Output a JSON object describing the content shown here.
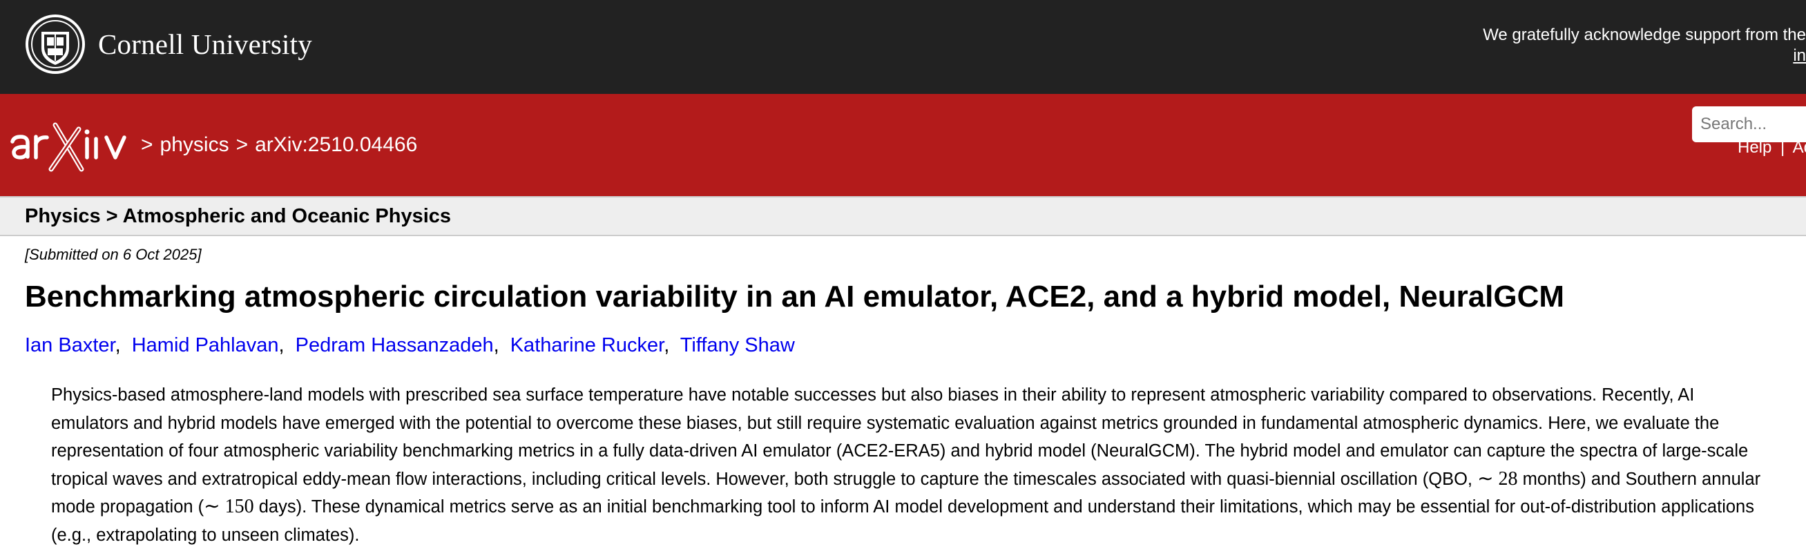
{
  "top_bar": {
    "institution_name": "Cornell University",
    "support_text": "We gratefully acknowledge support from the",
    "support_link_text": "in"
  },
  "header": {
    "logo_alt": "arXiv",
    "crumb_sep_1": ">",
    "crumb_category": "physics",
    "crumb_sep_2": ">",
    "crumb_id": "arXiv:2510.04466",
    "search_placeholder": "Search...",
    "help_link": "Help",
    "help_sep": "|",
    "advanced_link": "Adv"
  },
  "subject": {
    "text": "Physics > Atmospheric and Oceanic Physics"
  },
  "paper": {
    "submitted": "[Submitted on 6 Oct 2025]",
    "title": "Benchmarking atmospheric circulation variability in an AI emulator, ACE2, and a hybrid model, NeuralGCM",
    "authors": [
      "Ian Baxter",
      "Hamid Pahlavan",
      "Pedram Hassanzadeh",
      "Katharine Rucker",
      "Tiffany Shaw"
    ],
    "author_sep": ",",
    "abstract_part1": "Physics-based atmosphere-land models with prescribed sea surface temperature have notable successes but also biases in their ability to represent atmospheric variability compared to observations. Recently, AI emulators and hybrid models have emerged with the potential to overcome these biases, but still require systematic evaluation against metrics grounded in fundamental atmospheric dynamics. Here, we evaluate the representation of four atmospheric variability benchmarking metrics in a fully data-driven AI emulator (ACE2-ERA5) and hybrid model (NeuralGCM). The hybrid model and emulator can capture the spectra of large-scale tropical waves and extratropical eddy-mean flow interactions, including critical levels. However, both struggle to capture the timescales associated with quasi-biennial oscillation (QBO, ",
    "abstract_math1": "∼ 28",
    "abstract_part2": " months) and Southern annular mode propagation (",
    "abstract_math2": "∼ 150",
    "abstract_part3": " days). These dynamical metrics serve as an initial benchmarking tool to inform AI model development and understand their limitations, which may be essential for out-of-distribution applications (e.g., extrapolating to unseen climates)."
  },
  "colors": {
    "top_bar": "#222222",
    "header_red": "#b31b1b",
    "subject_bar": "#eeeeee",
    "link_blue": "#0000ee"
  },
  "icons": {
    "cornell_seal": "cornell-seal-icon",
    "arxiv_logo": "arxiv-logo-icon"
  }
}
